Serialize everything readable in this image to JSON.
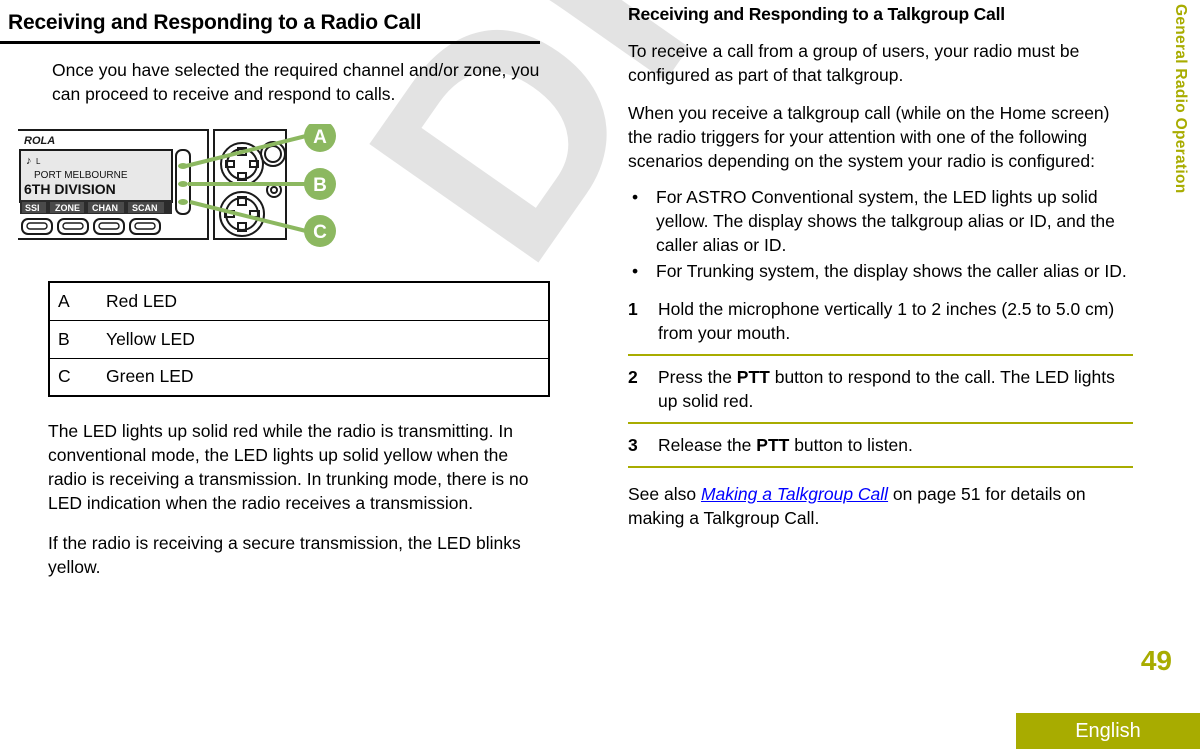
{
  "watermark": {
    "text": "Draft"
  },
  "left_column": {
    "heading": "Receiving and Responding to a Radio Call",
    "intro": "Once you have selected the required channel and/or zone, you can proceed to receive and respond to calls.",
    "figure": {
      "name": "radio-front-panel-illustration",
      "brand_text": "ROLA",
      "display": {
        "icons": "♪ L",
        "line1": "PORT MELBOURNE",
        "line2": "6TH DIVISION",
        "softkeys": [
          "SSI",
          "ZONE",
          "CHAN",
          "SCAN"
        ]
      },
      "callouts": [
        {
          "letter": "A",
          "target": "red-led"
        },
        {
          "letter": "B",
          "target": "yellow-led"
        },
        {
          "letter": "C",
          "target": "green-led"
        }
      ],
      "callout_color": "#8cb860"
    },
    "led_table": {
      "rows": [
        {
          "key": "A",
          "value": "Red LED"
        },
        {
          "key": "B",
          "value": "Yellow LED"
        },
        {
          "key": "C",
          "value": "Green LED"
        }
      ]
    },
    "paragraph_2": "The LED lights up solid red while the radio is transmitting. In conventional mode, the LED lights up solid yellow when the radio is receiving a transmission. In trunking mode, there is no LED indication when the radio receives a transmission.",
    "paragraph_3": "If the radio is receiving a secure transmission, the LED blinks yellow."
  },
  "right_column": {
    "heading": "Receiving and Responding to a Talkgroup Call",
    "paragraph_1": "To receive a call from a group of users, your radio must be configured as part of that talkgroup.",
    "paragraph_2": "When you receive a talkgroup call (while on the Home screen) the radio triggers for your attention with one of the following scenarios depending on the system your radio is configured:",
    "bullets": [
      {
        "marker": "•",
        "text": "For ASTRO Conventional system, the LED lights up solid yellow. The display shows the talkgroup alias or ID, and the caller alias or ID."
      },
      {
        "marker": "•",
        "text": "For Trunking system, the display shows the caller alias or ID."
      }
    ],
    "steps": [
      {
        "number": "1",
        "text_before": "Hold the microphone vertically 1 to 2 inches (2.5 to 5.0 cm) from your mouth.",
        "bold": "",
        "text_after": ""
      },
      {
        "number": "2",
        "text_before": "Press the ",
        "bold": "PTT",
        "text_after": " button to respond to the call. The LED lights up solid red."
      },
      {
        "number": "3",
        "text_before": "Release the ",
        "bold": "PTT",
        "text_after": " button to listen."
      }
    ],
    "see_also": {
      "prefix": "See also ",
      "link": "Making a Talkgroup Call",
      "suffix": " on page 51 for details on making a Talkgroup Call."
    }
  },
  "side_tab": {
    "label": "General Radio Operation",
    "color": "#a8ac00"
  },
  "footer": {
    "page_number": "49",
    "language": "English",
    "bar_color": "#a8ac00"
  }
}
